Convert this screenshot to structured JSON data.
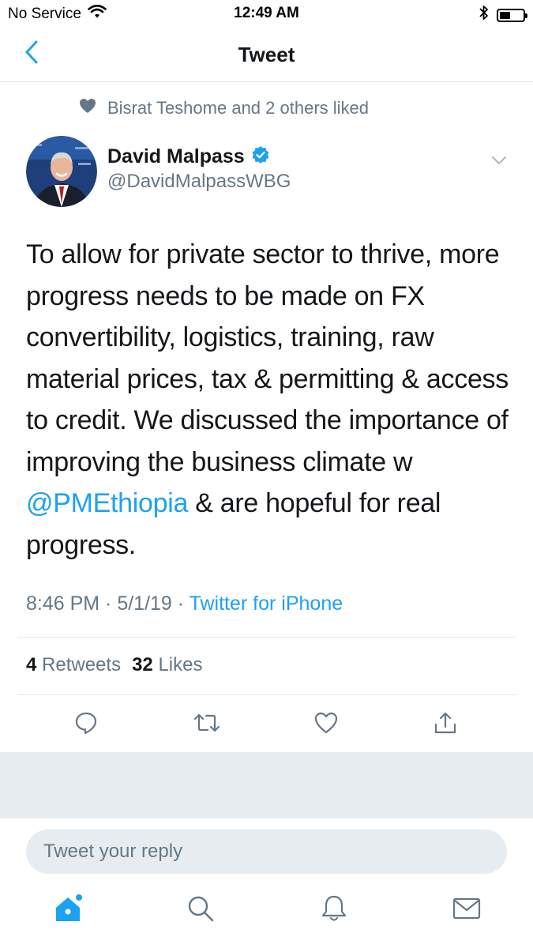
{
  "status_bar": {
    "carrier": "No Service",
    "time": "12:49 AM",
    "battery_level": 0.45
  },
  "nav": {
    "title": "Tweet"
  },
  "social_context": {
    "liked_text": "Bisrat Teshome and 2 others liked"
  },
  "tweet": {
    "author_name": "David Malpass",
    "author_handle": "@DavidMalpassWBG",
    "verified": true,
    "text_parts": [
      "To allow for private sector to thrive, more progress needs to be made on FX convertibility, logistics, training, raw material prices, tax & permitting & access to credit. We discussed the importance of improving the business climate w ",
      "@PMEthiopia",
      " & are hopeful for real progress."
    ],
    "time": "8:46 PM",
    "separator": " · ",
    "date": "5/1/19",
    "source": "Twitter for iPhone",
    "retweets_count": "4",
    "retweets_label": "Retweets",
    "likes_count": "32",
    "likes_label": "Likes"
  },
  "reply": {
    "placeholder": "Tweet your reply"
  },
  "colors": {
    "accent": "#1da1f2",
    "secondary_text": "#657786",
    "divider": "#e1e8ed",
    "band": "#e6ecf0"
  },
  "icons": {
    "back": "chevron-left-icon",
    "liked": "heart-icon",
    "verified": "verified-badge-icon",
    "more": "chevron-down-icon",
    "reply": "comment-icon",
    "retweet": "retweet-icon",
    "like": "heart-outline-icon",
    "share": "share-icon",
    "home": "home-icon",
    "search": "search-icon",
    "notifications": "bell-icon",
    "messages": "mail-icon"
  }
}
